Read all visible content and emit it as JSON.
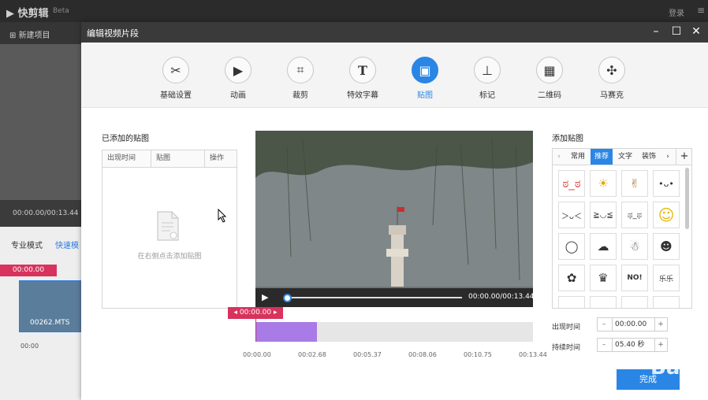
{
  "app": {
    "logo": "▶ 快剪辑",
    "beta": "Beta",
    "login": "登录",
    "menu_icon": "hamburger-menu-icon",
    "new_project": "新建项目",
    "time": "00:00.00/00:13.44",
    "mode_pro": "专业模式",
    "mode_fast": "快速模",
    "timeline_tag": "00:00.00",
    "clip_name": "00262.MTS",
    "zero": "00:00"
  },
  "dialog": {
    "title": "编辑视频片段",
    "tabs": [
      {
        "label": "基础设置",
        "icon": "scissors-icon"
      },
      {
        "label": "动画",
        "icon": "play-frame-icon"
      },
      {
        "label": "裁剪",
        "icon": "crop-icon"
      },
      {
        "label": "特效字幕",
        "icon": "text-icon"
      },
      {
        "label": "贴图",
        "icon": "image-icon",
        "active": true
      },
      {
        "label": "标记",
        "icon": "pin-icon"
      },
      {
        "label": "二维码",
        "icon": "qrcode-icon"
      },
      {
        "label": "马赛克",
        "icon": "mosaic-icon"
      }
    ],
    "added_title": "已添加的贴图",
    "table_headers": [
      "出现时间",
      "贴图",
      "操作"
    ],
    "empty_text": "在右侧点击添加贴图",
    "video_time": "00:00.00/00:13.44",
    "timeline_marker": "00:00.00",
    "ticks": [
      "00:00.00",
      "00:02.68",
      "00:05.37",
      "00:08.06",
      "00:10.75",
      "00:13.44"
    ],
    "add_title": "添加贴图",
    "categories": [
      "常用",
      "推荐",
      "文字",
      "装饰"
    ],
    "active_category": "推荐",
    "stickers": [
      "ಠ_ಠ",
      "☀",
      "✌",
      "•ᴗ•",
      "＞ᴗ＜",
      "≧◡≦",
      "ಥ_ಥ",
      "☺",
      "◯",
      "☁",
      "☃",
      "☻",
      "✿",
      "♛",
      "NO!",
      "乐乐"
    ],
    "appear_label": "出现时间",
    "appear_value": "00:00.00",
    "duration_label": "持续时间",
    "duration_value": "05.40 秒",
    "done": "完成",
    "watermark": "Baidu"
  }
}
